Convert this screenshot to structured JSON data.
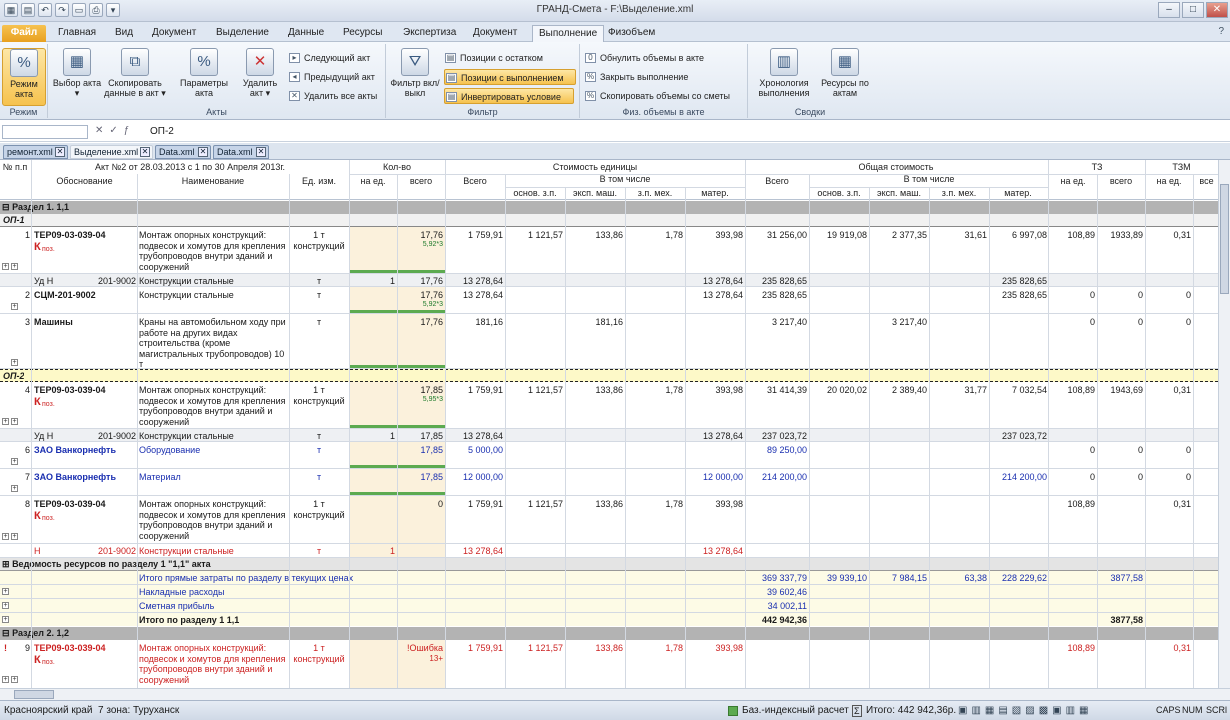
{
  "window": {
    "title": "ГРАНД-Смета - F:\\Выделение.xml"
  },
  "tabs": [
    "Файл",
    "Главная",
    "Вид",
    "Документ",
    "Выделение",
    "Данные",
    "Ресурсы",
    "Экспертиза",
    "Документ",
    "Выполнение",
    "Физобъем"
  ],
  "ribbon": {
    "rezhim": {
      "btn": "Режим акта",
      "group": "Режим"
    },
    "akty": {
      "vybor": "Выбор акта ▾",
      "kopir": "Скопировать данные в акт ▾",
      "param": "Параметры акта",
      "udalit": "Удалить акт ▾",
      "next": "Следующий акт",
      "prev": "Предыдущий акт",
      "delall": "Удалить все акты",
      "group": "Акты"
    },
    "filtr": {
      "btn": "Фильтр вкл/выкл",
      "ostatok": "Позиции с остатком",
      "vypoln": "Позиции с выполнением",
      "invert": "Инвертировать условие",
      "group": "Фильтр"
    },
    "fiz": {
      "obnul": "Обнулить объемы в акте",
      "zakryt": "Закрыть выполнение",
      "skop": "Скопировать объемы со сметы",
      "group": "Физ. объемы в акте"
    },
    "svodki": {
      "hron": "Хронология выполнения",
      "res": "Ресурсы по актам",
      "group": "Сводки"
    }
  },
  "formula": {
    "value": "ОП-2"
  },
  "doctabs": [
    "ремонт.xml",
    "Выделение.xml",
    "Data.xml",
    "Data.xml"
  ],
  "header": {
    "num": "№ п.п",
    "act": "Акт №2 от 28.03.2013 с 1 по 30 Апреля 2013г.",
    "obosn": "Обоснование",
    "naim": "Наименование",
    "ed": "Ед. изм.",
    "kolvo": "Кол-во",
    "naed": "на ед.",
    "vsego": "всего",
    "stoim_ed": "Стоимость единицы",
    "obsh": "Общая стоимость",
    "vsego2": "Всего",
    "vtom": "В том числе",
    "osn": "основ. з.п.",
    "eksp": "эксп. маш.",
    "zpmeh": "з.п. мех.",
    "mater": "матер.",
    "tz": "ТЗ",
    "tzm": "ТЗМ",
    "naed2": "на ед.",
    "vsego3": "всего",
    "vse": "все"
  },
  "rows": {
    "razdel1": "Раздел 1. 1,1",
    "op1": "ОП-1",
    "op2": "ОП-2",
    "r1": {
      "n": "1",
      "code": "ТЕР09-03-039-04",
      "k": "К",
      "kpoz": "поз.",
      "name": "Монтаж опорных конструкций: подвесок и хомутов для крепления трубопроводов внутри зданий и сооружений",
      "ed": "1 т конструкций",
      "vsego": "17,76",
      "f": "5,92*3",
      "ed_vsego": "1 759,91",
      "ed_osn": "1 121,57",
      "ed_eksp": "133,86",
      "ed_zpm": "1,78",
      "ed_mat": "393,98",
      "ob_vsego": "31 256,00",
      "ob_osn": "19 919,08",
      "ob_eksp": "2 377,35",
      "ob_zpm": "31,61",
      "ob_mat": "6 997,08",
      "tz_ed": "108,89",
      "tz_vs": "1933,89",
      "tzm_ed": "0,31"
    },
    "u1": {
      "a": "Уд Н",
      "code": "201-9002",
      "name": "Конструкции стальные",
      "ed": "т",
      "naed": "1",
      "vsego": "17,76",
      "ed_vsego": "13 278,64",
      "ed_mat": "13 278,64",
      "ob_vsego": "235 828,65",
      "ob_mat": "235 828,65"
    },
    "r2": {
      "n": "2",
      "code": "СЦМ-201-9002",
      "name": "Конструкции стальные",
      "ed": "т",
      "vsego": "17,76",
      "f": "5,92*3",
      "ed_vsego": "13 278,64",
      "ed_mat": "13 278,64",
      "ob_vsego": "235 828,65",
      "ob_mat": "235 828,65",
      "tz_ed": "0",
      "tz_vs": "0",
      "tzm_ed": "0"
    },
    "r3": {
      "n": "3",
      "code": "Машины",
      "name": "Краны на автомобильном ходу при работе на других видах строительства (кроме магистральных трубопроводов) 10 т",
      "ed": "т",
      "vsego": "17,76",
      "ed_vsego": "181,16",
      "ed_eksp": "181,16",
      "ob_vsego": "3 217,40",
      "ob_eksp": "3 217,40",
      "tz_ed": "0",
      "tz_vs": "0",
      "tzm_ed": "0"
    },
    "r4": {
      "n": "4",
      "code": "ТЕР09-03-039-04",
      "k": "К",
      "kpoz": "поз.",
      "name": "Монтаж опорных конструкций: подвесок и хомутов для крепления трубопроводов внутри зданий и сооружений",
      "ed": "1 т конструкций",
      "vsego": "17,85",
      "f": "5,95*3",
      "ed_vsego": "1 759,91",
      "ed_osn": "1 121,57",
      "ed_eksp": "133,86",
      "ed_zpm": "1,78",
      "ed_mat": "393,98",
      "ob_vsego": "31 414,39",
      "ob_osn": "20 020,02",
      "ob_eksp": "2 389,40",
      "ob_zpm": "31,77",
      "ob_mat": "7 032,54",
      "tz_ed": "108,89",
      "tz_vs": "1943,69",
      "tzm_ed": "0,31"
    },
    "u4": {
      "a": "Уд Н",
      "code": "201-9002",
      "name": "Конструкции стальные",
      "ed": "т",
      "naed": "1",
      "vsego": "17,85",
      "ed_vsego": "13 278,64",
      "ed_mat": "13 278,64",
      "ob_vsego": "237 023,72",
      "ob_mat": "237 023,72"
    },
    "r6": {
      "n": "6",
      "code": "ЗАО Ванкорнефть",
      "name": "Оборудование",
      "ed": "т",
      "vsego": "17,85",
      "ed_vsego": "5 000,00",
      "ob_vsego": "89 250,00",
      "tz_ed": "0",
      "tz_vs": "0",
      "tzm_ed": "0"
    },
    "r7": {
      "n": "7",
      "code": "ЗАО Ванкорнефть",
      "name": "Материал",
      "ed": "т",
      "vsego": "17,85",
      "ed_vsego": "12 000,00",
      "ed_mat": "12 000,00",
      "ob_vsego": "214 200,00",
      "ob_mat": "214 200,00",
      "tz_ed": "0",
      "tz_vs": "0",
      "tzm_ed": "0"
    },
    "r8": {
      "n": "8",
      "code": "ТЕР09-03-039-04",
      "k": "К",
      "kpoz": "поз.",
      "name": "Монтаж опорных конструкций: подвесок и хомутов для крепления трубопроводов внутри зданий и сооружений",
      "ed": "1 т конструкций",
      "vsego": "0",
      "ed_vsego": "1 759,91",
      "ed_osn": "1 121,57",
      "ed_eksp": "133,86",
      "ed_zpm": "1,78",
      "ed_mat": "393,98",
      "tz_ed": "108,89",
      "tzm_ed": "0,31"
    },
    "u8": {
      "a": "Н",
      "code": "201-9002",
      "name": "Конструкции стальные",
      "ed": "т",
      "naed": "1",
      "ed_vsego": "13 278,64",
      "ed_mat": "13 278,64"
    },
    "ved": "Ведомость ресурсов по разделу 1 \"1,1\" акта",
    "itogo_pr": {
      "label": "Итого прямые затраты по разделу в текущих ценах",
      "ob_vsego": "369 337,79",
      "ob_osn": "39 939,10",
      "ob_eksp": "7 984,15",
      "ob_zpm": "63,38",
      "ob_mat": "228 229,62",
      "tz_vs": "3877,58"
    },
    "nakl": {
      "label": "Накладные расходы",
      "v": "39 602,46"
    },
    "smet": {
      "label": "Сметная прибыль",
      "v": "34 002,11"
    },
    "itogo": {
      "label": "Итого по разделу 1 1,1",
      "v": "442 942,36",
      "tz": "3877,58"
    },
    "razdel2": "Раздел 2. 1,2",
    "r9": {
      "n": "9",
      "code": "ТЕР09-03-039-04",
      "k": "К",
      "kpoz": "поз.",
      "name": "Монтаж опорных конструкций: подвесок и хомутов для крепления трубопроводов внутри зданий и сооружений",
      "ed": "1 т конструкций",
      "err": "!Ошибка",
      "f": "13+",
      "ed_vsego": "1 759,91",
      "ed_osn": "1 121,57",
      "ed_eksp": "133,86",
      "ed_zpm": "1,78",
      "ed_mat": "393,98",
      "tz_ed": "108,89",
      "tzm_ed": "0,31"
    }
  },
  "status": {
    "region": "Красноярский край",
    "zone": "7 зона: Туруханск",
    "calc": "Баз.-индексный расчет",
    "total": "Итого: 442 942,36р.",
    "caps": "CAPS",
    "num": "NUM",
    "scrl": "SCRl"
  }
}
